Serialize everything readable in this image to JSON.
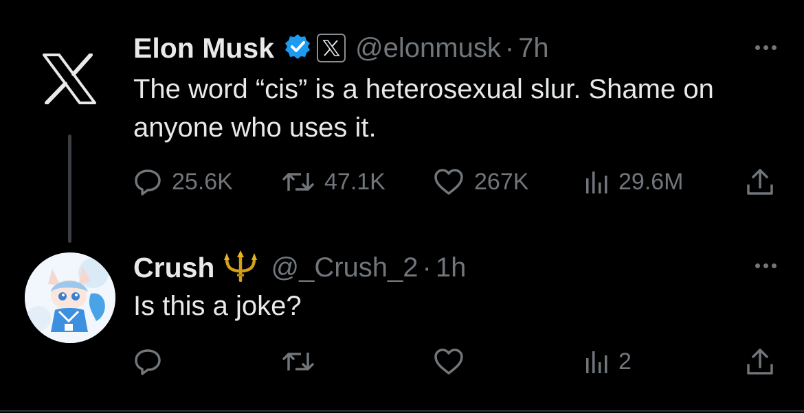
{
  "post": {
    "author_name": "Elon Musk",
    "handle": "@elonmusk",
    "separator": "·",
    "time": "7h",
    "text": "The word “cis” is a heterosexual slur. Shame on anyone who uses it.",
    "stats": {
      "replies": "25.6K",
      "reposts": "47.1K",
      "likes": "267K",
      "views": "29.6M"
    }
  },
  "reply": {
    "author_name": "Crush",
    "handle": "@_Crush_2",
    "separator": "·",
    "time": "1h",
    "text": "Is this a joke?",
    "stats": {
      "views": "2"
    }
  },
  "icons": {
    "avatar": "x-logo-icon",
    "verified": "verified-badge-icon",
    "affiliate": "x-affiliate-badge-icon",
    "emoji": "trident-icon",
    "more": "more-horizontal-icon",
    "reply": "reply-icon",
    "repost": "repost-icon",
    "like": "heart-icon",
    "views": "views-chart-icon",
    "share": "share-icon"
  },
  "colors": {
    "background": "#000000",
    "text": "#e7e9ea",
    "muted": "#71767b",
    "verified": "#1d9bf0"
  }
}
